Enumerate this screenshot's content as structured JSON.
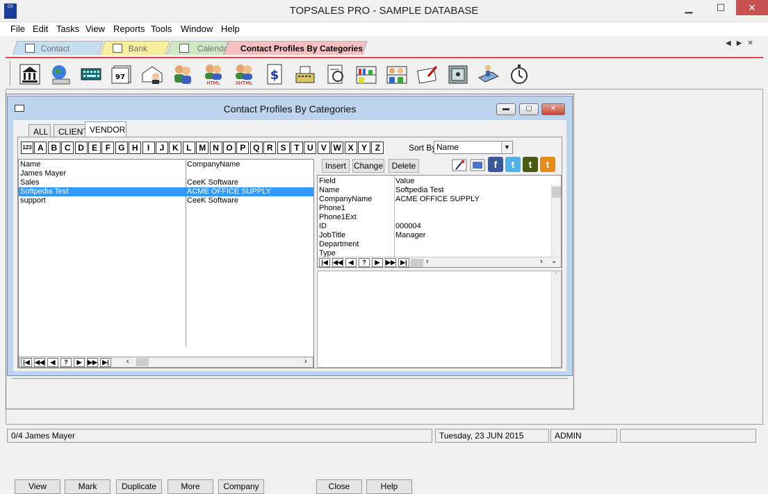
{
  "window": {
    "title": "TOPSALES PRO - SAMPLE DATABASE",
    "icon_text": "CK"
  },
  "menu": [
    "File",
    "Edit",
    "Tasks",
    "View",
    "Reports",
    "Tools",
    "Window",
    "Help"
  ],
  "top_tabs": [
    {
      "label": "Contact Profiles",
      "color": "#c6dff0",
      "active": false
    },
    {
      "label": "Bank Book",
      "color": "#f8ef9e",
      "active": false
    },
    {
      "label": "Calendar",
      "color": "#cfe8c4",
      "active": false
    },
    {
      "label": "Contact Profiles By Categories",
      "color": "#f6c0c0",
      "active": true
    }
  ],
  "accent_red": "#e24a4a",
  "toolbar_icons": [
    "bank-icon",
    "globe-computer-icon",
    "keyboard-icon",
    "calendar-97-icon",
    "envelope-person-icon",
    "people-icon",
    "people-html-icon",
    "people-xhtml-icon",
    "dollar-document-icon",
    "cash-register-icon",
    "document-scan-icon",
    "shelves-icon",
    "shelves-people-icon",
    "document-pen-icon",
    "safe-icon",
    "tray-hand-icon",
    "stopwatch-icon"
  ],
  "child": {
    "title": "Contact Profiles By Categories",
    "tabs": [
      "ALL",
      "CLIENT",
      "VENDOR"
    ],
    "active_tab": "VENDOR",
    "alphabet": [
      "123",
      "A",
      "B",
      "C",
      "D",
      "E",
      "F",
      "G",
      "H",
      "I",
      "J",
      "K",
      "L",
      "M",
      "N",
      "O",
      "P",
      "Q",
      "R",
      "S",
      "T",
      "U",
      "V",
      "W",
      "X",
      "Y",
      "Z"
    ],
    "sort_label": "Sort By",
    "sort_value": "Name",
    "actions": {
      "insert": "Insert",
      "change": "Change",
      "delete": "Delete"
    },
    "list": {
      "headers": {
        "name": "Name",
        "company": "CompanyName"
      },
      "rows": [
        {
          "name": "James Mayer",
          "company": ""
        },
        {
          "name": "Sales",
          "company": "CeeK Software"
        },
        {
          "name": "Softpedia Test",
          "company": "ACME OFFICE SUPPLY",
          "selected": true
        },
        {
          "name": "support",
          "company": "CeeK Software"
        }
      ]
    },
    "detail": {
      "headers": {
        "field": "Field",
        "value": "Value"
      },
      "rows": [
        {
          "field": "Name",
          "value": "Softpedia Test"
        },
        {
          "field": "CompanyName",
          "value": "ACME OFFICE SUPPLY"
        },
        {
          "field": "Phone1",
          "value": ""
        },
        {
          "field": "Phone1Ext",
          "value": ""
        },
        {
          "field": "ID",
          "value": "000004"
        },
        {
          "field": "JobTitle",
          "value": "Manager"
        },
        {
          "field": "Department",
          "value": ""
        },
        {
          "field": "Type",
          "value": ""
        }
      ]
    },
    "social": [
      {
        "name": "facebook-icon",
        "glyph": "f",
        "color": "#3b5998"
      },
      {
        "name": "twitter-icon",
        "glyph": "t",
        "color": "#4fb3e8"
      },
      {
        "name": "tumblr-green-icon",
        "glyph": "t",
        "color": "#4a5a10"
      },
      {
        "name": "tumblr-orange-icon",
        "glyph": "t",
        "color": "#e88a1a"
      }
    ]
  },
  "nav_glyphs": [
    "|◀",
    "◀◀",
    "◀",
    "?",
    "▶",
    "▶▶",
    "▶|"
  ],
  "bottom_buttons": {
    "view": "View",
    "mark": "Mark",
    "duplicate": "Duplicate",
    "more": "More",
    "company": "Company",
    "close": "Close",
    "help": "Help"
  },
  "status": {
    "record": "0/4  James Mayer",
    "date": "Tuesday, 23 JUN 2015",
    "user": "ADMIN"
  }
}
